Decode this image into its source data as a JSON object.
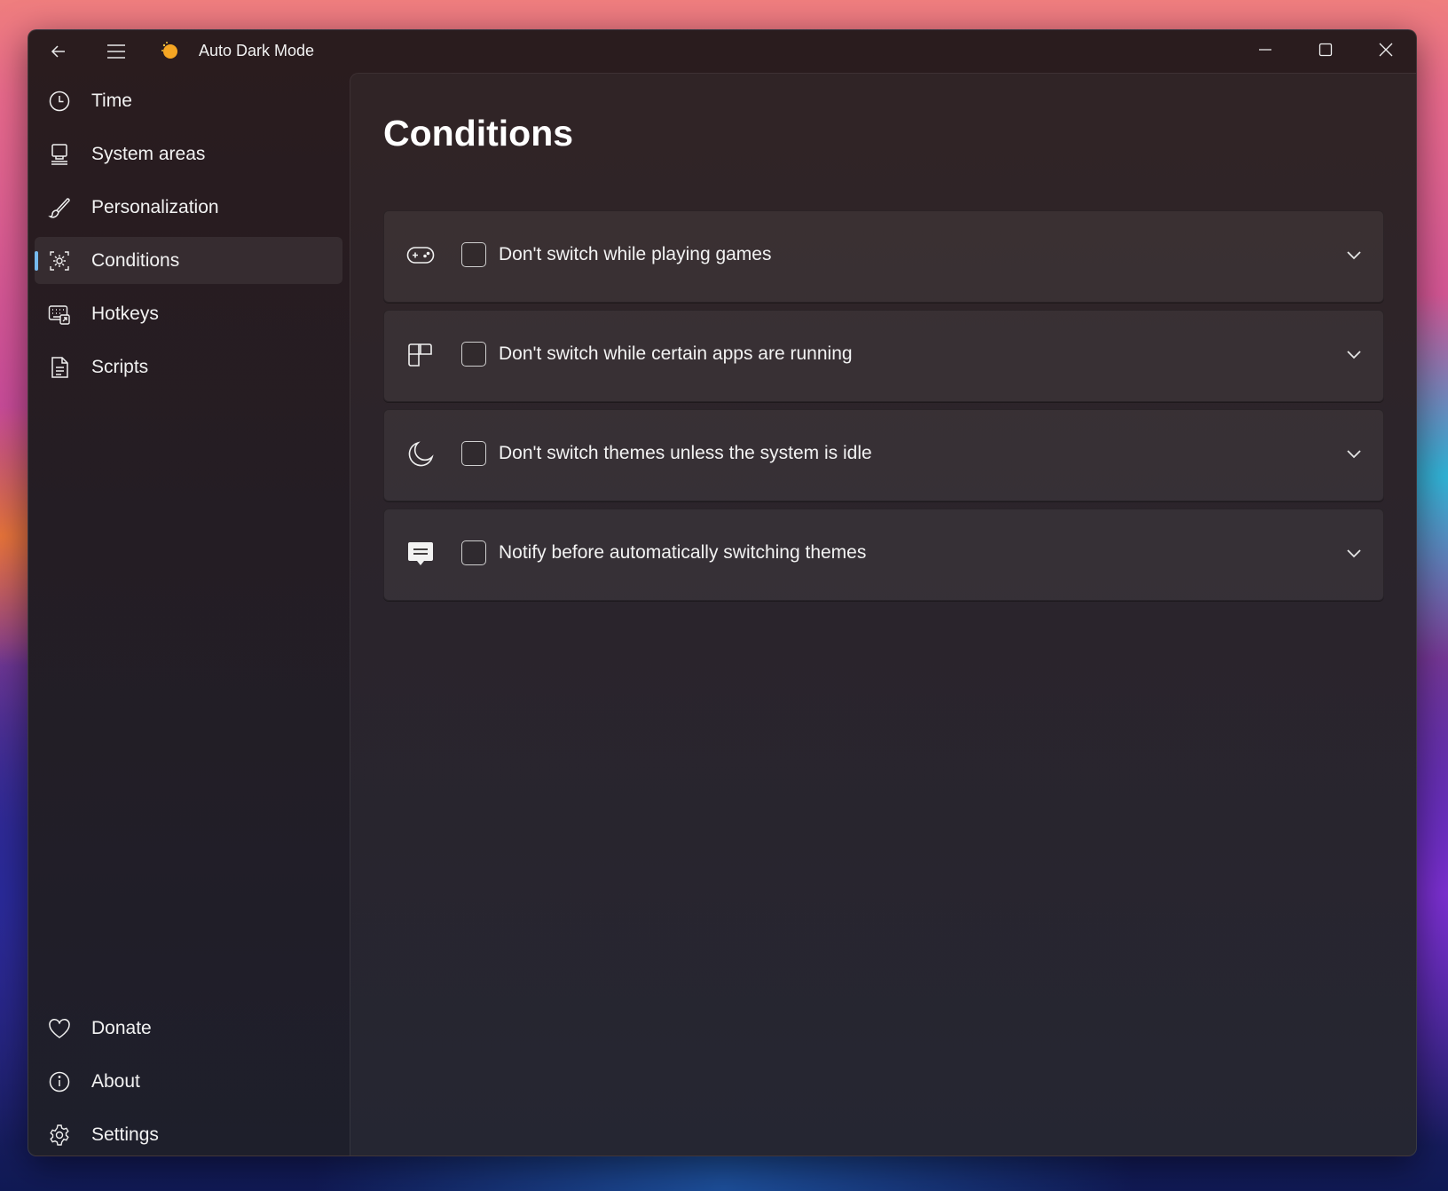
{
  "window": {
    "title": "Auto Dark Mode",
    "accent_color": "#76b9ed"
  },
  "titlebar": {
    "back_icon": "back-arrow-icon",
    "menu_icon": "hamburger-menu-icon",
    "logo_icon": "auto-dark-mode-logo-icon",
    "caption_buttons": [
      "minimize",
      "maximize",
      "close"
    ]
  },
  "sidebar": {
    "items": [
      {
        "label": "Time",
        "icon": "clock-icon"
      },
      {
        "label": "System areas",
        "icon": "computer-icon"
      },
      {
        "label": "Personalization",
        "icon": "brush-icon"
      },
      {
        "label": "Conditions",
        "icon": "conditions-gear-icon",
        "selected": true
      },
      {
        "label": "Hotkeys",
        "icon": "keyboard-icon"
      },
      {
        "label": "Scripts",
        "icon": "document-icon"
      }
    ],
    "footer_items": [
      {
        "label": "Donate",
        "icon": "heart-icon"
      },
      {
        "label": "About",
        "icon": "info-icon"
      },
      {
        "label": "Settings",
        "icon": "gear-icon"
      }
    ]
  },
  "main": {
    "title": "Conditions",
    "cards": [
      {
        "label": "Don't switch while playing games",
        "icon": "gamepad-icon",
        "checked": false
      },
      {
        "label": "Don't switch while certain apps are running",
        "icon": "apps-icon",
        "checked": false
      },
      {
        "label": "Don't switch themes unless the system is idle",
        "icon": "moon-icon",
        "checked": false
      },
      {
        "label": "Notify before automatically switching themes",
        "icon": "message-icon",
        "checked": false
      }
    ]
  }
}
